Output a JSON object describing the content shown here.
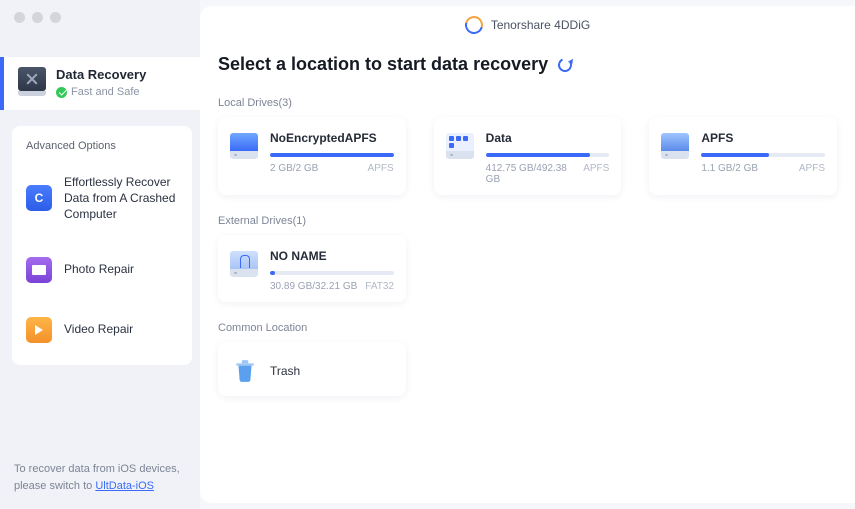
{
  "app": {
    "title": "Tenorshare 4DDiG"
  },
  "heading": "Select a location to start data recovery",
  "sidebar": {
    "nav": {
      "title": "Data Recovery",
      "subtitle": "Fast and Safe"
    },
    "advanced_title": "Advanced Options",
    "items": [
      {
        "label": "Effortlessly Recover Data from A Crashed Computer"
      },
      {
        "label": "Photo Repair"
      },
      {
        "label": "Video Repair"
      }
    ],
    "footer_pre": "To recover data from iOS devices, please switch to ",
    "footer_link": "UltData-iOS"
  },
  "sections": {
    "local": {
      "label": "Local Drives(3)",
      "drives": [
        {
          "name": "NoEncryptedAPFS",
          "size": "2 GB/2 GB",
          "fs": "APFS",
          "fill": 100
        },
        {
          "name": "Data",
          "size": "412.75 GB/492.38 GB",
          "fs": "APFS",
          "fill": 84
        },
        {
          "name": "APFS",
          "size": "1.1 GB/2 GB",
          "fs": "APFS",
          "fill": 55
        }
      ]
    },
    "external": {
      "label": "External Drives(1)",
      "drives": [
        {
          "name": "NO NAME",
          "size": "30.89 GB/32.21 GB",
          "fs": "FAT32",
          "fill": 4
        }
      ]
    },
    "common": {
      "label": "Common Location",
      "items": [
        {
          "label": "Trash"
        }
      ]
    }
  }
}
